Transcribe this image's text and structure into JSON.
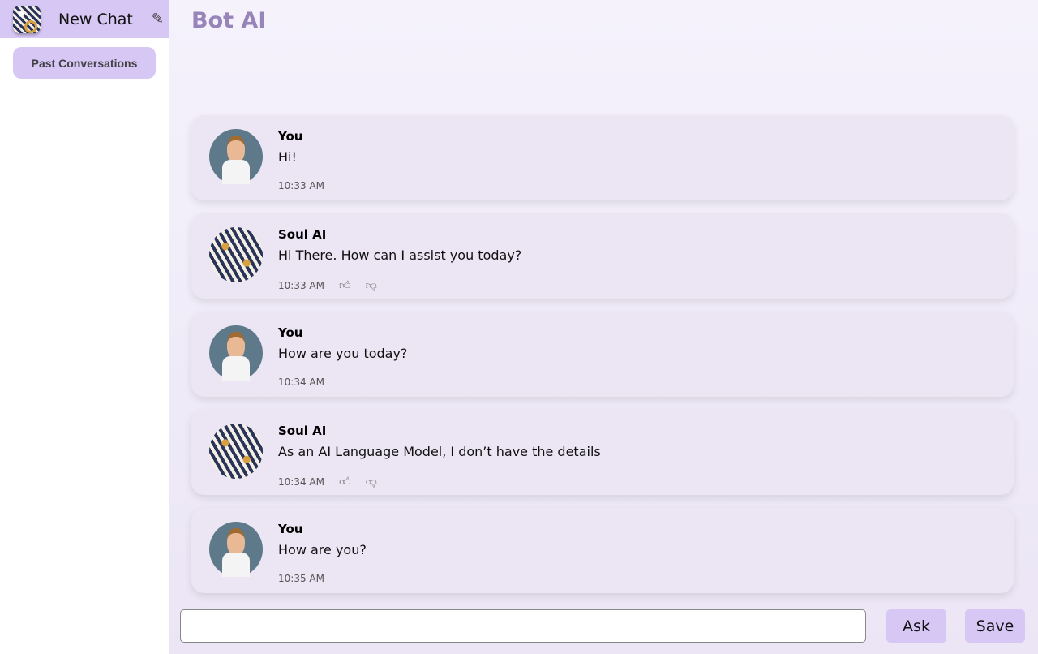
{
  "sidebar": {
    "new_chat": "New Chat",
    "past_conversations": "Past Conversations"
  },
  "header": {
    "title": "Bot AI"
  },
  "messages": [
    {
      "sender": "You",
      "text": "Hi!",
      "time": "10:33 AM",
      "type": "user"
    },
    {
      "sender": "Soul AI",
      "text": "Hi There. How can I assist you today?",
      "time": "10:33 AM",
      "type": "bot"
    },
    {
      "sender": "You",
      "text": "How are you today?",
      "time": "10:34 AM",
      "type": "user"
    },
    {
      "sender": "Soul AI",
      "text": "As an AI Language Model, I don’t have the details",
      "time": "10:34 AM",
      "type": "bot"
    },
    {
      "sender": "You",
      "text": "How are you?",
      "time": "10:35 AM",
      "type": "user"
    }
  ],
  "composer": {
    "value": "",
    "ask": "Ask",
    "save": "Save"
  }
}
